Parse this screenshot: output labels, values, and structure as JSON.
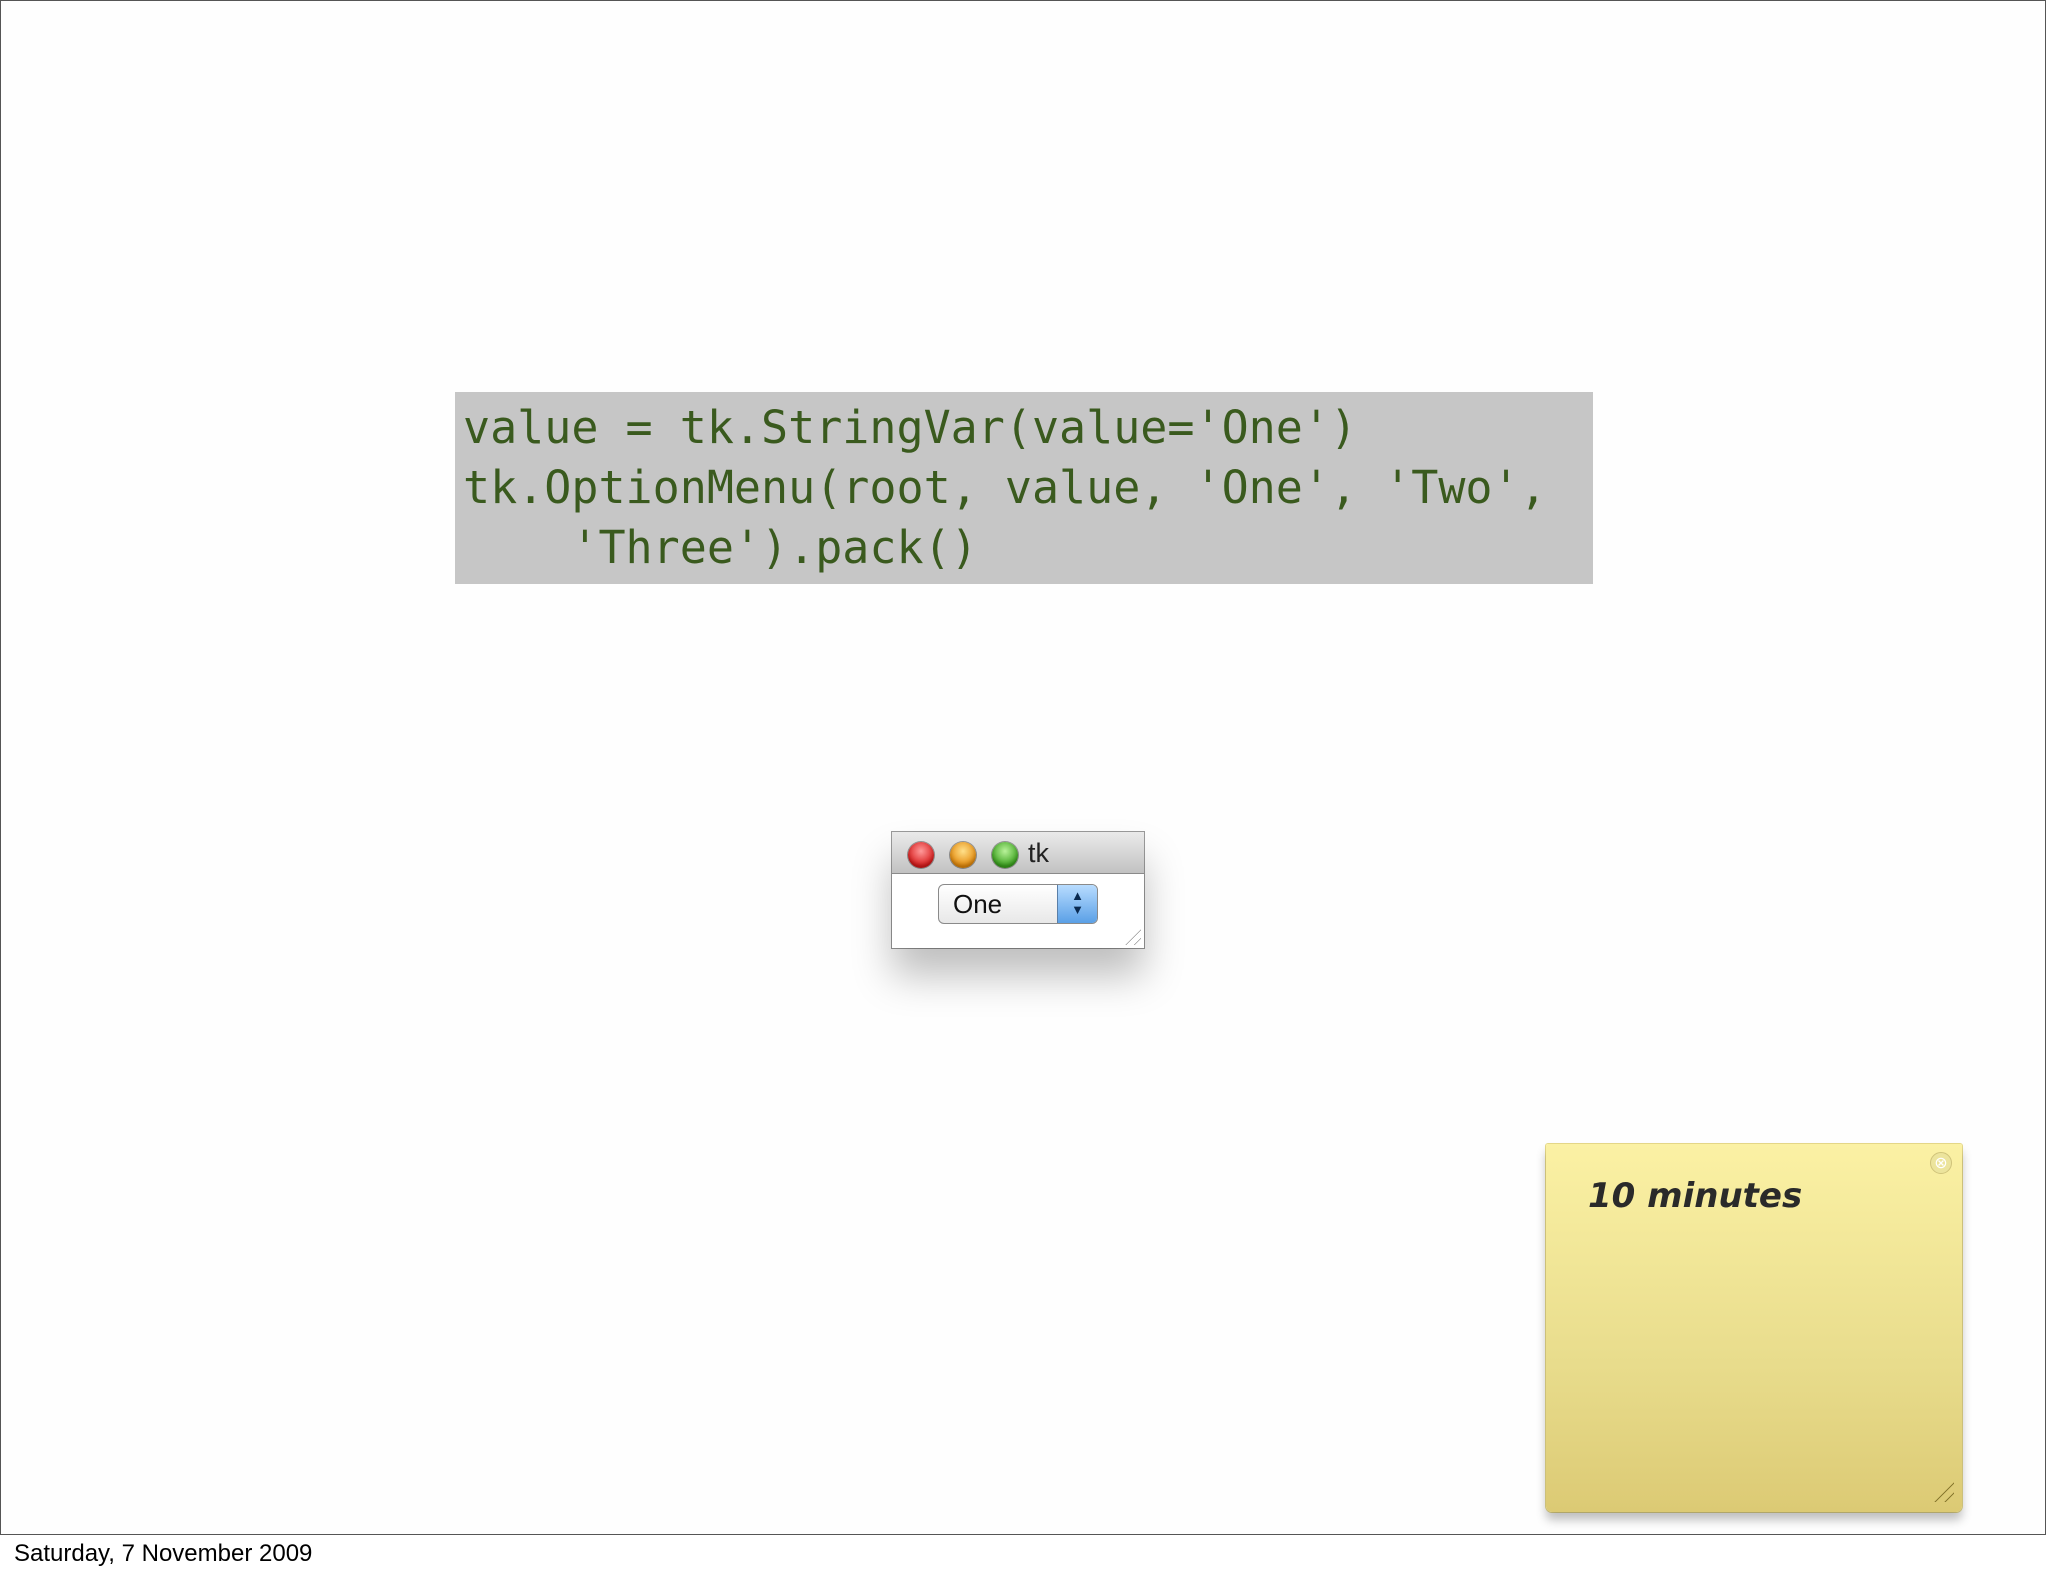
{
  "code": {
    "lines": [
      "value = tk.StringVar(value='One')",
      "tk.OptionMenu(root, value, 'One', 'Two',",
      "    'Three').pack()"
    ]
  },
  "tk_window": {
    "title": "tk",
    "option_menu": {
      "selected": "One",
      "arrows": "▲\n▼"
    }
  },
  "sticky_note": {
    "text": "10 minutes",
    "close_icon": "⊗"
  },
  "footer": {
    "date": "Saturday, 7 November 2009"
  },
  "colors": {
    "code_text": "#3a5a1e",
    "code_background": "#c6c6c6",
    "sticky_note": "#f5e99a"
  }
}
